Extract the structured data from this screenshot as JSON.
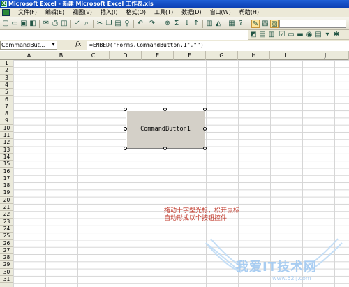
{
  "window": {
    "title": "Microsoft Excel - 新建 Microsoft Excel 工作表.xls"
  },
  "menu": [
    "文件(F)",
    "编辑(E)",
    "视图(V)",
    "插入(I)",
    "格式(O)",
    "工具(T)",
    "数据(D)",
    "窗口(W)",
    "帮助(H)"
  ],
  "formula_bar": {
    "name_box": "CommandBut...",
    "fx_label": "fx",
    "formula": "=EMBED(\"Forms.CommandButton.1\",\"\")"
  },
  "sheet": {
    "columns": [
      "A",
      "B",
      "C",
      "D",
      "E",
      "F",
      "G",
      "H",
      "I",
      "J"
    ],
    "rows": [
      "1",
      "2",
      "3",
      "4",
      "5",
      "6",
      "7",
      "8",
      "9",
      "10",
      "11",
      "12",
      "13",
      "14",
      "15",
      "16",
      "17",
      "18",
      "19",
      "20",
      "21",
      "22",
      "23",
      "24",
      "25",
      "26",
      "27",
      "28",
      "29",
      "30",
      "31"
    ]
  },
  "command_button": {
    "label": "CommandButton1"
  },
  "annotation": {
    "line1": "拖动十字型光标，松开鼠标",
    "line2": "自动形成以个按钮控件"
  },
  "watermark": {
    "text": "我爱IT技术网",
    "sub": "www.52ij.com"
  },
  "colors": {
    "title_bar": "#0b3fb3",
    "annotation": "#c0392b",
    "watermark": "#a9cdf1"
  }
}
